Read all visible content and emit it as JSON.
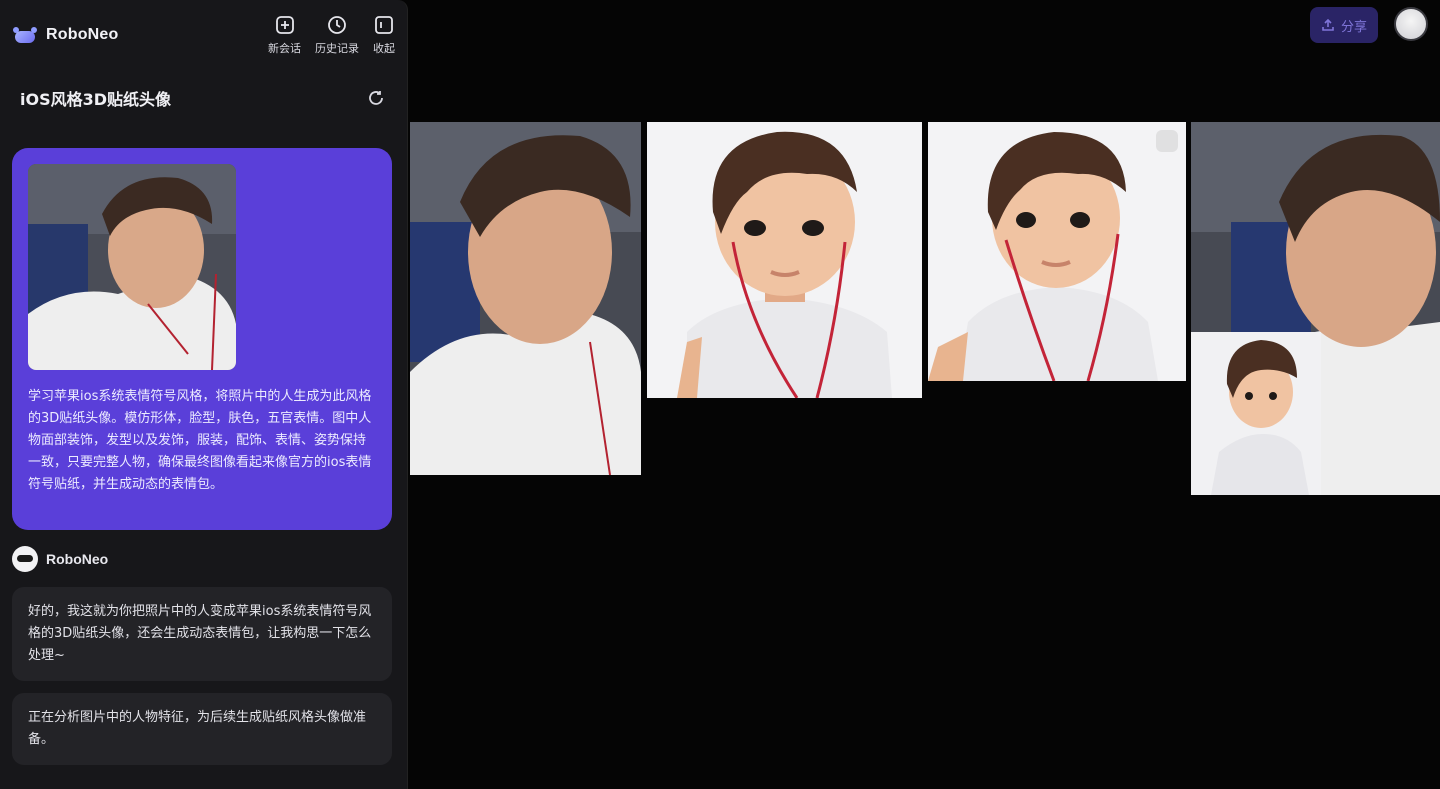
{
  "app": {
    "name": "RoboNeo"
  },
  "toolbar": {
    "new_chat_label": "新会话",
    "history_label": "历史记录",
    "collapse_label": "收起"
  },
  "session": {
    "title": "iOS风格3D贴纸头像"
  },
  "user_message": {
    "text": "学习苹果ios系统表情符号风格，将照片中的人生成为此风格的3D贴纸头像。模仿形体，脸型，肤色，五官表情。图中人物面部装饰，发型以及发饰，服装，配饰、表情、姿势保持一致，只要完整人物，确保最终图像看起来像官方的ios表情符号贴纸，并生成动态的表情包。"
  },
  "bot": {
    "name": "RoboNeo",
    "message_1": "好的，我这就为你把照片中的人变成苹果ios系统表情符号风格的3D贴纸头像，还会生成动态表情包，让我构思一下怎么处理~",
    "message_2": "正在分析图片中的人物特征，为后续生成贴纸风格头像做准备。"
  },
  "header": {
    "share_label": "分享"
  },
  "colors": {
    "sidebar_bg": "#17171a",
    "user_bubble": "#5a3fd9",
    "bot_bubble": "#232327",
    "canvas_bg": "#050505"
  },
  "icons": {
    "new_chat": "plus-square-icon",
    "history": "clock-icon",
    "collapse": "sidebar-collapse-icon",
    "refresh": "refresh-icon",
    "share": "share-icon"
  }
}
